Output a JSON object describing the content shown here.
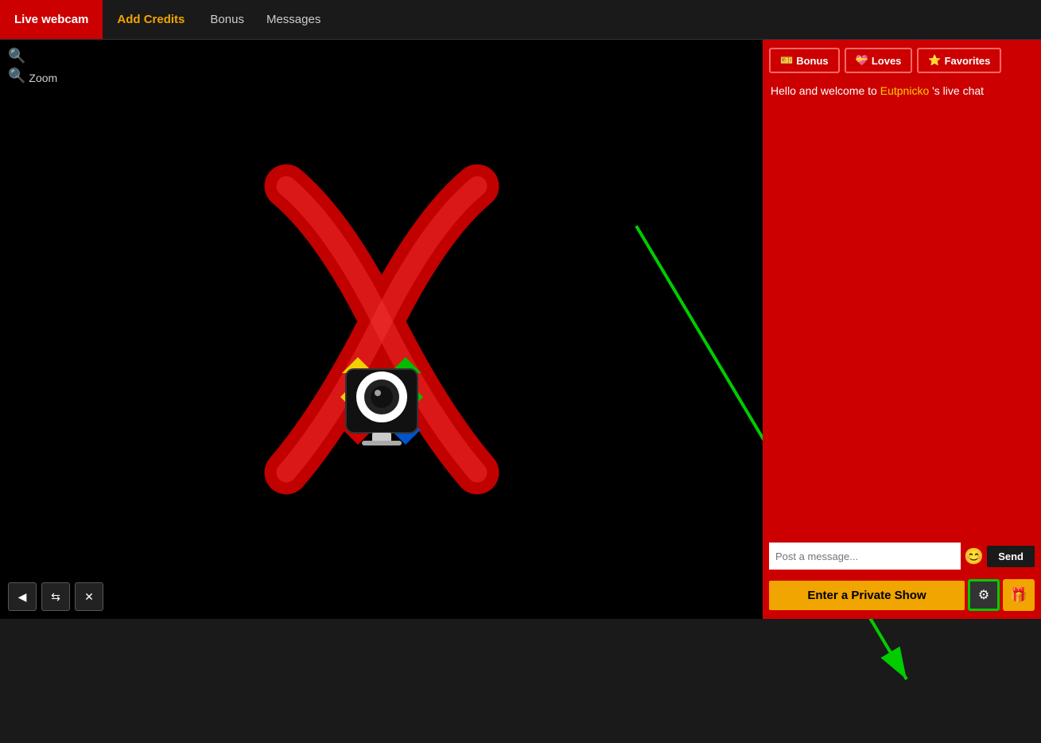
{
  "nav": {
    "live_webcam": "Live webcam",
    "add_credits": "Add Credits",
    "bonus": "Bonus",
    "messages": "Messages"
  },
  "video": {
    "zoom_label": "Zoom",
    "search_icon": "🔍",
    "bottom_controls": [
      {
        "icon": "◀",
        "name": "prev-btn"
      },
      {
        "icon": "⇆",
        "name": "adjust-btn"
      },
      {
        "icon": "✕",
        "name": "close-btn"
      }
    ]
  },
  "chat": {
    "bonus_btn": "Bonus",
    "loves_btn": "Loves",
    "favorites_btn": "Favorites",
    "welcome_prefix": "Hello and welcome to ",
    "username": "Eutpnicko",
    "welcome_suffix": " 's live chat",
    "input_placeholder": "Post a message...",
    "send_btn": "Send",
    "emoji_icon": "😊",
    "private_show_btn": "Enter a Private Show",
    "settings_icon": "⚙",
    "gift_icon": "🎁"
  }
}
